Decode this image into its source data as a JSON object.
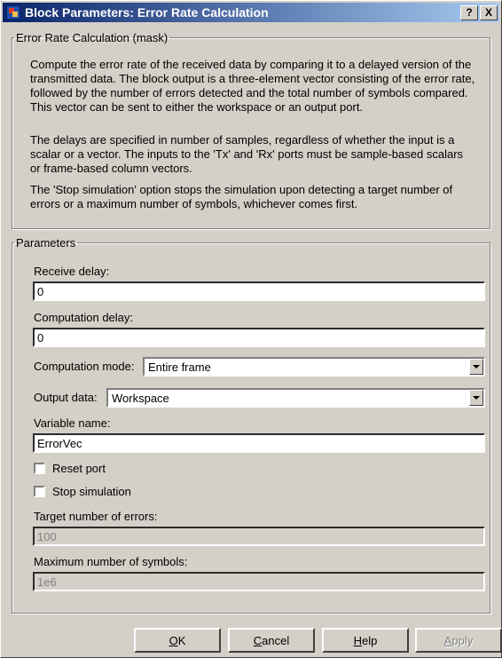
{
  "window": {
    "title": "Block Parameters: Error Rate Calculation",
    "help_btn": "?",
    "close_btn": "X"
  },
  "mask": {
    "legend": "Error Rate Calculation (mask)",
    "paragraphs": [
      "Compute the error rate of the received data by comparing it to a delayed version of the transmitted data. The block output is a three-element vector consisting of the error rate, followed by the number of errors detected and the total number of symbols compared. This vector can be sent to either the workspace or an output port.",
      "The delays are specified in number of samples, regardless of whether the input is a scalar or a vector. The inputs to the 'Tx' and 'Rx' ports must be sample-based scalars or frame-based column vectors.",
      "The 'Stop simulation' option stops the simulation upon detecting a target number of errors or a maximum number of symbols, whichever comes first."
    ]
  },
  "params": {
    "legend": "Parameters",
    "receive_delay_label": "Receive delay:",
    "receive_delay_value": "0",
    "computation_delay_label": "Computation delay:",
    "computation_delay_value": "0",
    "computation_mode_label": "Computation mode:",
    "computation_mode_value": "Entire frame",
    "output_data_label": "Output data:",
    "output_data_value": "Workspace",
    "variable_name_label": "Variable name:",
    "variable_name_value": "ErrorVec",
    "reset_port_label": "Reset port",
    "stop_simulation_label": "Stop simulation",
    "target_errors_label": "Target number of errors:",
    "target_errors_value": "100",
    "max_symbols_label": "Maximum number of symbols:",
    "max_symbols_value": "1e6"
  },
  "buttons": {
    "ok_mnemonic": "O",
    "ok_rest": "K",
    "cancel_mnemonic": "C",
    "cancel_rest": "ancel",
    "help_mnemonic": "H",
    "help_rest": "elp",
    "apply_mnemonic": "A",
    "apply_rest": "pply"
  }
}
